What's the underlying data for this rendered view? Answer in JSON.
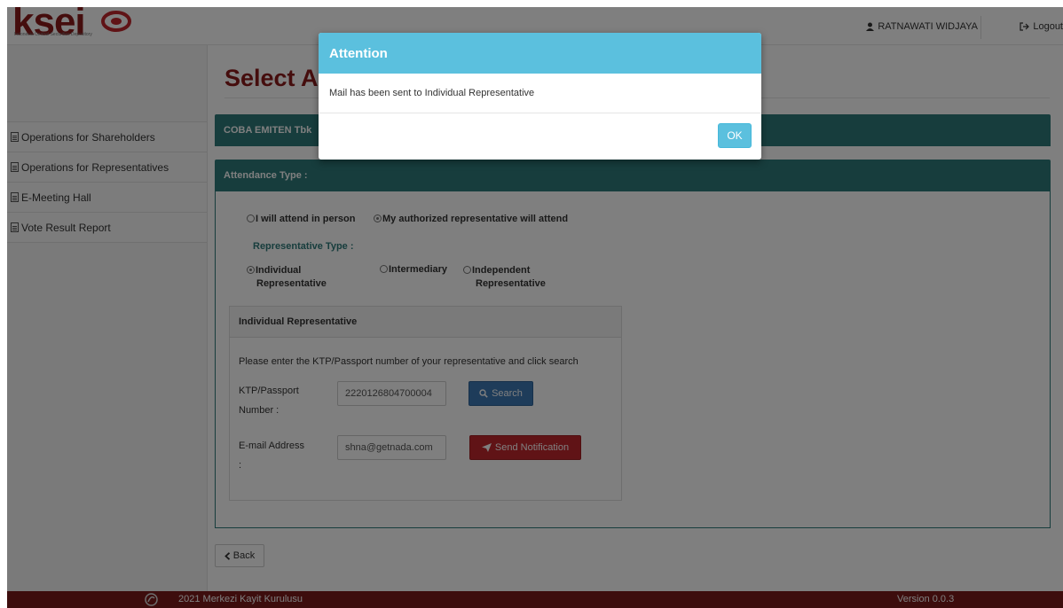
{
  "logo": {
    "text": "ksei",
    "subtitle": "Indonesia Central Securities Depository"
  },
  "header": {
    "user_name": "RATNAWATI WIDJAYA",
    "logout_label": "Logout"
  },
  "sidebar": {
    "items": [
      {
        "label": "Operations for Shareholders"
      },
      {
        "label": "Operations for Representatives"
      },
      {
        "label": "E-Meeting Hall"
      },
      {
        "label": "Vote Result Report"
      }
    ]
  },
  "main": {
    "page_title": "Select A",
    "company_name": "COBA EMITEN Tbk",
    "attendance_label": "Attendance Type :",
    "attend_options": {
      "in_person": "I will attend in person",
      "representative": "My authorized representative will attend",
      "selected": "representative"
    },
    "rep_type_label": "Representative Type :",
    "rep_options": {
      "individual_line1": "Individual",
      "individual_line2": "Representative",
      "intermediary": "Intermediary",
      "independent_line1": "Independent",
      "independent_line2": "Representative",
      "selected": "individual"
    },
    "individual_panel": {
      "title": "Individual Representative",
      "instruction": "Please enter the KTP/Passport number of your representative and click search",
      "ktp_label_line1": "KTP/Passport",
      "ktp_label_line2": "Number :",
      "ktp_value": "2220126804700004",
      "search_label": "Search",
      "email_label_line1": "E-mail Address",
      "email_label_line2": ":",
      "email_value": "shna@getnada.com",
      "send_label": "Send Notification"
    },
    "back_label": "Back"
  },
  "footer": {
    "copyright": "2021 Merkezi Kayit Kurulusu",
    "version": "Version 0.0.3"
  },
  "modal": {
    "title": "Attention",
    "message": "Mail has been sent to Individual Representative",
    "ok_label": "OK"
  },
  "colors": {
    "brand_red": "#8b1a1a",
    "teal": "#2f7b7b",
    "modal_blue": "#5bc0de",
    "search_blue": "#3c78b4",
    "send_red": "#c1272d",
    "footer_red": "#7a1a1a"
  }
}
